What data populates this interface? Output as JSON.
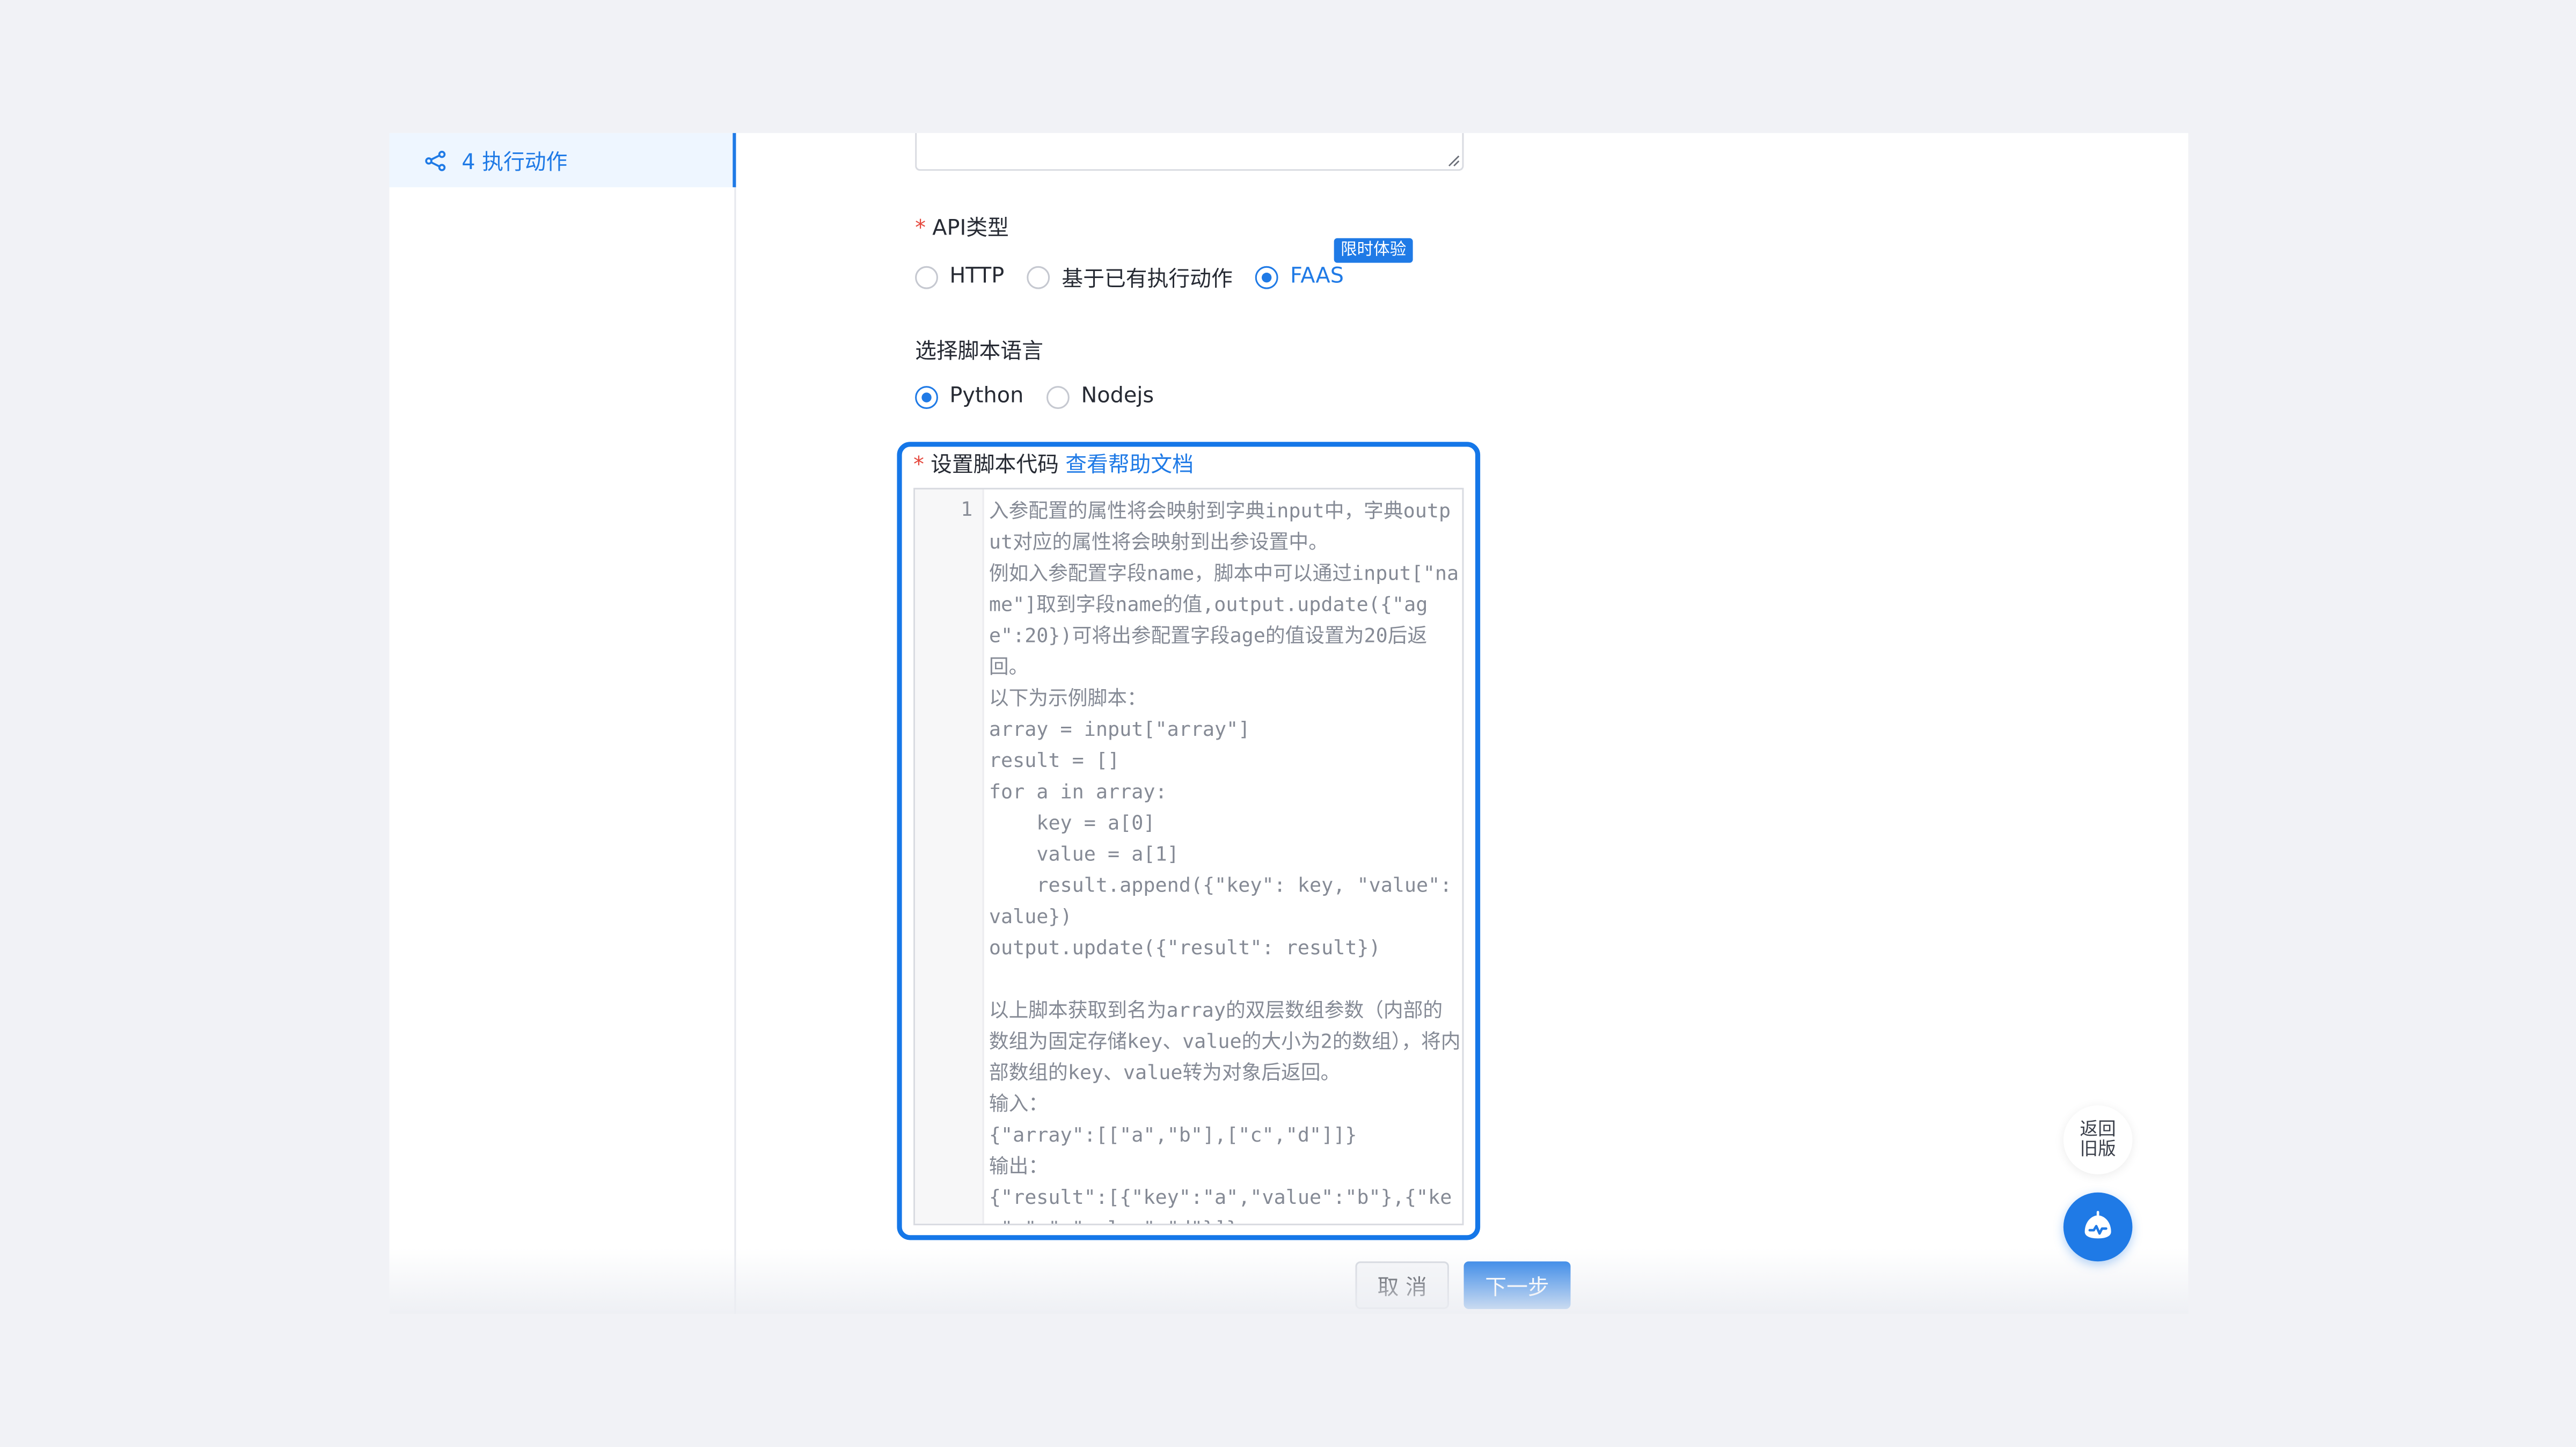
{
  "sidebar": {
    "active_step": "4 执行动作"
  },
  "form": {
    "api_type": {
      "label": "API类型",
      "options": [
        "HTTP",
        "基于已有执行动作",
        "FAAS"
      ],
      "selected": "FAAS",
      "badge": "限时体验"
    },
    "script_language": {
      "label": "选择脚本语言",
      "options": [
        "Python",
        "Nodejs"
      ],
      "selected": "Python"
    },
    "script_code": {
      "label": "设置脚本代码",
      "help_link": "查看帮助文档",
      "line_number": "1",
      "content": "入参配置的属性将会映射到字典input中，字典output对应的属性将会映射到出参设置中。\n例如入参配置字段name，脚本中可以通过input[\"name\"]取到字段name的值,output.update({\"age\":20})可将出参配置字段age的值设置为20后返回。\n以下为示例脚本：\narray = input[\"array\"]\nresult = []\nfor a in array:\n    key = a[0]\n    value = a[1]\n    result.append({\"key\": key, \"value\":value})\noutput.update({\"result\": result})\n\n以上脚本获取到名为array的双层数组参数（内部的数组为固定存储key、value的大小为2的数组），将内部数组的key、value转为对象后返回。\n输入：\n{\"array\":[[\"a\",\"b\"],[\"c\",\"d\"]]}\n输出：\n{\"result\":[{\"key\":\"a\",\"value\":\"b\"},{\"key\":\"c\",\"value\":\"d\"}]}"
    }
  },
  "buttons": {
    "cancel": "取 消",
    "next": "下一步"
  },
  "floating": {
    "back_old": "返回旧版",
    "assistant_icon": "assistant-icon"
  },
  "colors": {
    "primary": "#1f7ae6",
    "highlight_border": "#1577e8",
    "required": "#e5483d",
    "background": "#f1f2f6"
  }
}
